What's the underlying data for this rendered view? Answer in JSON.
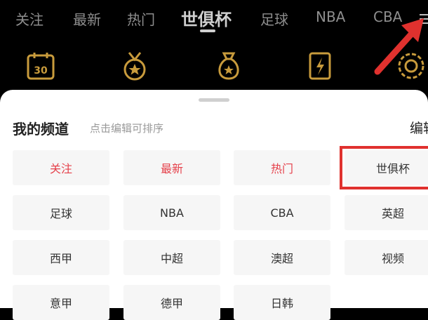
{
  "tabs": [
    {
      "label": "关注"
    },
    {
      "label": "最新"
    },
    {
      "label": "热门"
    },
    {
      "label": "世俱杯"
    },
    {
      "label": "足球"
    },
    {
      "label": "NBA"
    },
    {
      "label": "CBA"
    }
  ],
  "shortcut_icons": [
    "calendar-30-icon",
    "medal-icon",
    "money-bag-icon",
    "lightning-card-icon",
    "gear-badge-icon"
  ],
  "sheet": {
    "title": "我的频道",
    "hint": "点击编辑可排序",
    "edit_label": "编辑"
  },
  "channels": [
    {
      "label": "关注"
    },
    {
      "label": "最新"
    },
    {
      "label": "热门"
    },
    {
      "label": "世俱杯"
    },
    {
      "label": "足球"
    },
    {
      "label": "NBA"
    },
    {
      "label": "CBA"
    },
    {
      "label": "英超"
    },
    {
      "label": "西甲"
    },
    {
      "label": "中超"
    },
    {
      "label": "澳超"
    },
    {
      "label": "视频"
    },
    {
      "label": "意甲"
    },
    {
      "label": "德甲"
    },
    {
      "label": "日韩"
    }
  ],
  "colors": {
    "accent_red": "#e5414b",
    "icon_gold": "#c89b3c",
    "annotation_red": "#e0312e"
  }
}
